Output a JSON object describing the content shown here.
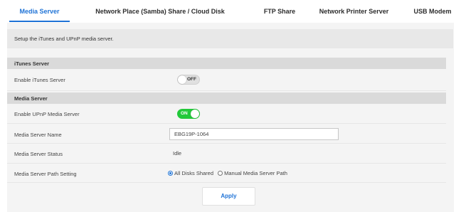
{
  "tabs": [
    {
      "label": "Media Server",
      "active": true
    },
    {
      "label": "Network Place (Samba) Share / Cloud Disk",
      "active": false
    },
    {
      "label": "FTP Share",
      "active": false
    },
    {
      "label": "Network Printer Server",
      "active": false
    },
    {
      "label": "USB Modem",
      "active": false
    }
  ],
  "description": "Setup the iTunes and UPnP media server.",
  "itunes": {
    "section_title": "iTunes Server",
    "enable_label": "Enable iTunes Server",
    "toggle_text": "OFF",
    "toggle_state": "off"
  },
  "media_server": {
    "section_title": "Media Server",
    "enable_label": "Enable UPnP Media Server",
    "toggle_text": "ON",
    "toggle_state": "on",
    "name_label": "Media Server Name",
    "name_value": "EBG19P-1064",
    "status_label": "Media Server Status",
    "status_value": "Idle",
    "path_label": "Media Server Path Setting",
    "path_options": [
      {
        "label": "All Disks Shared",
        "checked": true
      },
      {
        "label": "Manual Media Server Path",
        "checked": false
      }
    ]
  },
  "apply_label": "Apply",
  "colors": {
    "accent": "#1f73d6",
    "toggle_on": "#22c93a",
    "toggle_off": "#e0e0e0"
  }
}
